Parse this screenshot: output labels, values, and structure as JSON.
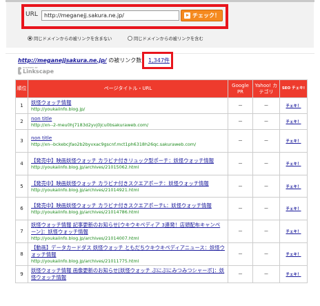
{
  "form": {
    "url_label": "URL",
    "url_value": "http://meganejj.sakura.ne.jp/",
    "check_button": "チェック！",
    "radio_left": "同じドメインからの被リンクを含まない",
    "radio_right": "同じドメインからの被リンクを含む",
    "radio_selected": "left"
  },
  "result": {
    "url": "http://meganejjsakura.ne.jp/",
    "suffix": " の被リンク数 ",
    "count": "1,347件",
    "logo_powered": "POWERED BY",
    "logo_name": "Linkscape"
  },
  "table": {
    "headers": {
      "rank": "順位",
      "title": "ページタイトル・URL",
      "google": "Google PR",
      "yahoo": "Yahoo! カテゴリ",
      "seo": "SEO チェキ!"
    },
    "rows": [
      {
        "rank": "1",
        "title": "妖怪ウォッチ情報",
        "url": "http://youkaiinfo.blog.jp/",
        "google": "－",
        "yahoo": "－",
        "seo": "チェキ！"
      },
      {
        "rank": "2",
        "title": "non title",
        "url": "http://xn--2-meu0hj7183d2yvj0jcu0bsakuraweb.com/",
        "google": "－",
        "yahoo": "－",
        "seo": "チェキ！"
      },
      {
        "rank": "3",
        "title": "non title",
        "url": "http://xn--bckebcjfao2b2byvxac9gscnf.mct1ph6318h26qc.sakuraweb.com/",
        "google": "－",
        "yahoo": "－",
        "seo": "チェキ！"
      },
      {
        "rank": "4",
        "title": "【発売中】映画妖怪ウォッチ カラビナ付きリュック型ポーチ：妖怪ウォッチ情報",
        "url": "http://youkaiinfo.blog.jp/archives/21015062.html",
        "google": "－",
        "yahoo": "－",
        "seo": "チェキ！"
      },
      {
        "rank": "5",
        "title": "【発売中】映画妖怪ウォッチ カラビナ付きスクエアポーチ：妖怪ウォッチ情報",
        "url": "http://youkaiinfo.blog.jp/archives/21014921.html",
        "google": "－",
        "yahoo": "－",
        "seo": "チェキ！"
      },
      {
        "rank": "6",
        "title": "【発売中】映画妖怪ウォッチ カラビナ付きスクエアポーチL：妖怪ウォッチ情報",
        "url": "http://youkaiinfo.blog.jp/archives/21014786.html",
        "google": "－",
        "yahoo": "－",
        "seo": "チェキ！"
      },
      {
        "rank": "7",
        "title": "妖怪ウォッチ情報 記事更新のお知らせ[ウキウキペディア 3連発！店頭配布キャンペーン]：妖怪ウォッチ情報",
        "url": "http://youkaiinfo.blog.jp/archives/21014007.html",
        "google": "－",
        "yahoo": "－",
        "seo": "チェキ！"
      },
      {
        "rank": "8",
        "title": "【動画】データカードダス 妖怪ウォッチ ともだちウキウキペディアニュース：妖怪ウォッチ情報",
        "url": "http://youkaiinfo.blog.jp/archives/21011775.html",
        "google": "－",
        "yahoo": "－",
        "seo": "チェキ！"
      },
      {
        "rank": "9",
        "title": "妖怪ウォッチ情報 画像更新のお知らせ[妖怪ウォッチ ぷにぷにみつみつシャーボ]：妖怪ウォッチ情報",
        "url": "",
        "google": "－",
        "yahoo": "－",
        "seo": "チェキ！"
      }
    ]
  },
  "colors": {
    "highlight": "#e8141c",
    "header_red": "#ee3b2d",
    "link_blue": "#1a1a9c",
    "url_green": "#1c8a1c",
    "button_orange": "#f58a1f"
  }
}
